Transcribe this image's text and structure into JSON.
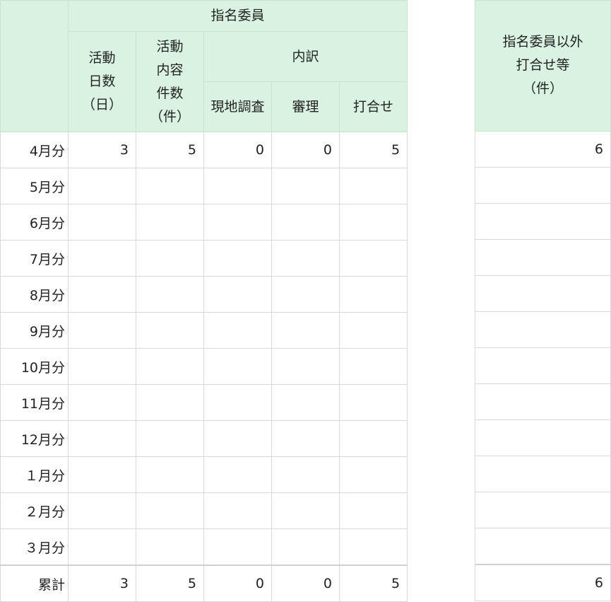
{
  "header": {
    "group_title": "指名委員",
    "col_activity_days": [
      "活動",
      "日数",
      "（日）"
    ],
    "col_activity_count": [
      "活動",
      "内容",
      "件数",
      "（件）"
    ],
    "breakdown_title": "内訳",
    "col_site_survey": "現地調査",
    "col_review": "審理",
    "col_meeting": "打合せ",
    "side_title": [
      "指名委員以外",
      "打合せ等",
      "（件）"
    ]
  },
  "rows": [
    {
      "label": "4月分",
      "days": "3",
      "count": "5",
      "site": "0",
      "review": "0",
      "meeting": "5",
      "other": "6"
    },
    {
      "label": "5月分",
      "days": "",
      "count": "",
      "site": "",
      "review": "",
      "meeting": "",
      "other": ""
    },
    {
      "label": "6月分",
      "days": "",
      "count": "",
      "site": "",
      "review": "",
      "meeting": "",
      "other": ""
    },
    {
      "label": "7月分",
      "days": "",
      "count": "",
      "site": "",
      "review": "",
      "meeting": "",
      "other": ""
    },
    {
      "label": "8月分",
      "days": "",
      "count": "",
      "site": "",
      "review": "",
      "meeting": "",
      "other": ""
    },
    {
      "label": "9月分",
      "days": "",
      "count": "",
      "site": "",
      "review": "",
      "meeting": "",
      "other": ""
    },
    {
      "label": "10月分",
      "days": "",
      "count": "",
      "site": "",
      "review": "",
      "meeting": "",
      "other": ""
    },
    {
      "label": "11月分",
      "days": "",
      "count": "",
      "site": "",
      "review": "",
      "meeting": "",
      "other": ""
    },
    {
      "label": "12月分",
      "days": "",
      "count": "",
      "site": "",
      "review": "",
      "meeting": "",
      "other": ""
    },
    {
      "label": "１月分",
      "days": "",
      "count": "",
      "site": "",
      "review": "",
      "meeting": "",
      "other": ""
    },
    {
      "label": "２月分",
      "days": "",
      "count": "",
      "site": "",
      "review": "",
      "meeting": "",
      "other": ""
    },
    {
      "label": "３月分",
      "days": "",
      "count": "",
      "site": "",
      "review": "",
      "meeting": "",
      "other": ""
    }
  ],
  "total": {
    "label": "累計",
    "days": "3",
    "count": "5",
    "site": "0",
    "review": "0",
    "meeting": "5",
    "other": "6"
  },
  "colors": {
    "header_bg": "#d9f2e1",
    "grid": "#d8d8d8"
  }
}
